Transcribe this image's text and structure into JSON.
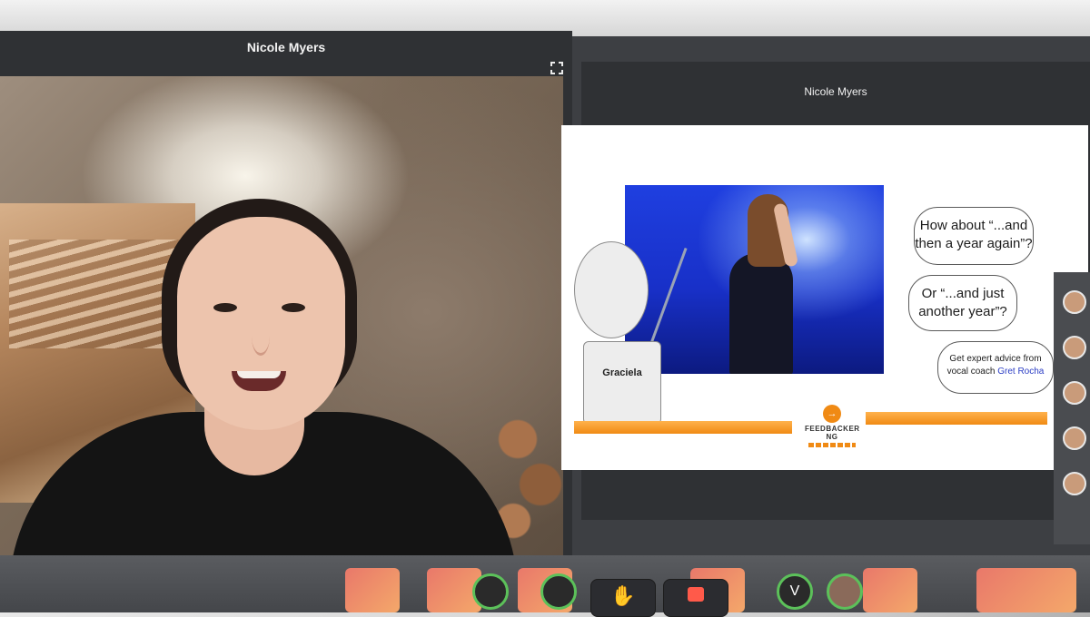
{
  "left_tile": {
    "participant_name": "Nicole Myers",
    "expand_icon": "expand-icon"
  },
  "right_tile": {
    "participant_name": "Nicole Myers",
    "slide": {
      "name_card_label": "Graciela",
      "bubble1": "How about “...and then a year again”?",
      "bubble2": "Or “...and just another year”?",
      "bubble3_prefix": "Get expert advice from vocal coach ",
      "bubble3_coach": "Gret Rocha",
      "logo_text": "FEEDBACKER NG",
      "logo_glyph": "→"
    }
  },
  "toolbar": {
    "avatar_letter": "V",
    "raise_hand_icon": "raise-hand-icon",
    "share_icon": "share-screen-icon",
    "colors": {
      "accent_orange": "#f08a14",
      "slide_coach_link": "#2a3cc4",
      "share_red": "#ff5a4a",
      "active_ring": "#5cc15a"
    }
  }
}
